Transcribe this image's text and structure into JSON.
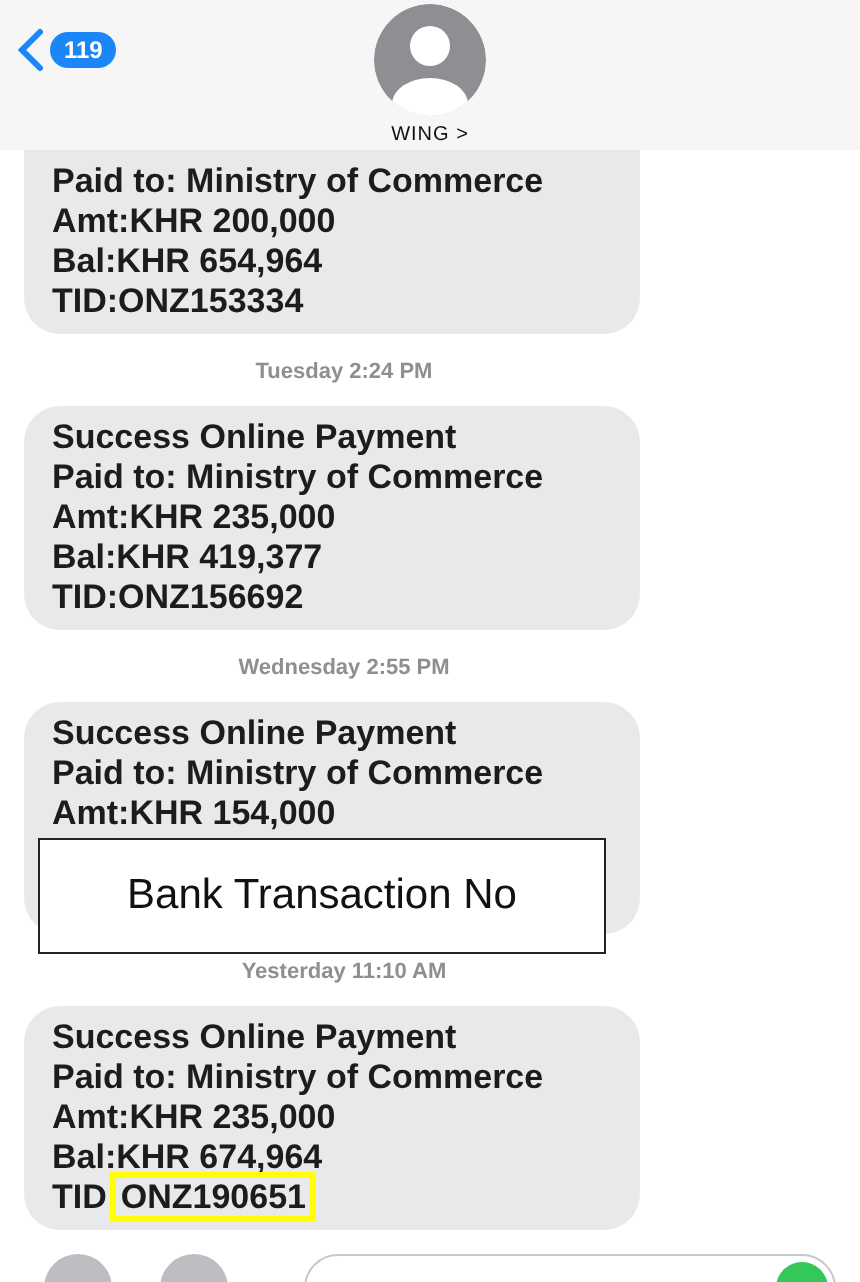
{
  "header": {
    "back_count": "119",
    "contact": "WING >"
  },
  "thread": [
    {
      "kind": "message",
      "lines": [
        {
          "text": "Paid to: Ministry of Commerce"
        },
        {
          "text": "Amt:KHR 200,000"
        },
        {
          "text": "Bal:KHR 654,964"
        },
        {
          "text": "TID:ONZ153334"
        }
      ]
    },
    {
      "kind": "time",
      "text": "Tuesday 2:24 PM"
    },
    {
      "kind": "message",
      "lines": [
        {
          "text": "Success Online Payment"
        },
        {
          "text": "Paid to: Ministry of Commerce"
        },
        {
          "text": "Amt:KHR 235,000"
        },
        {
          "text": "Bal:KHR 419,377"
        },
        {
          "text": "TID:ONZ156692"
        }
      ]
    },
    {
      "kind": "time",
      "text": "Wednesday 2:55 PM"
    },
    {
      "kind": "message",
      "callout": "Bank Transaction No",
      "lines": [
        {
          "text": "Success Online Payment"
        },
        {
          "text": "Paid to: Ministry of Commerce"
        },
        {
          "text": "Amt:KHR 154,000"
        }
      ]
    },
    {
      "kind": "time",
      "text": "Yesterday 11:10 AM"
    },
    {
      "kind": "message",
      "lines": [
        {
          "text": "Success Online Payment"
        },
        {
          "text": "Paid to: Ministry of Commerce"
        },
        {
          "text": "Amt:KHR 235,000"
        },
        {
          "text": "Bal:KHR 674,964"
        },
        {
          "text": "TID",
          "highlighted": "ONZ190651"
        }
      ]
    }
  ]
}
